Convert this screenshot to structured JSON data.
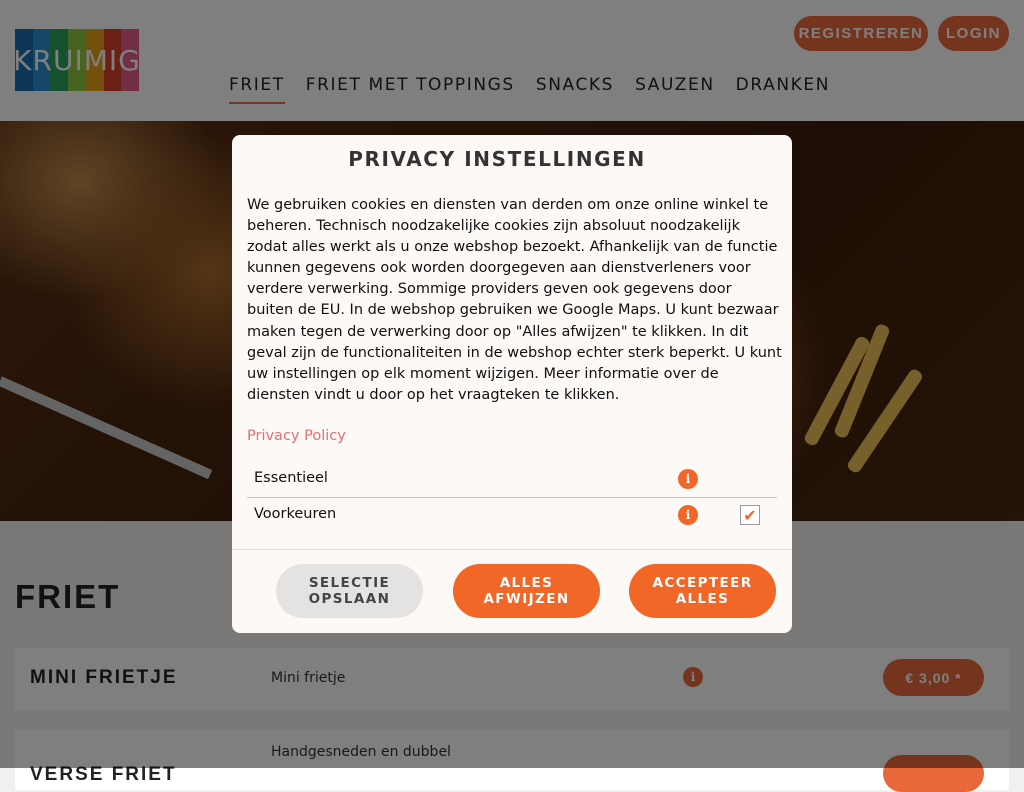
{
  "header": {
    "logo_text": "KRUIMIG",
    "logo_colors": [
      "#1a6fae",
      "#2a8fd0",
      "#2ca25f",
      "#8cc63f",
      "#e8a317",
      "#d9412b",
      "#e45c8a"
    ],
    "buttons": {
      "register": "REGISTREREN",
      "login": "LOGIN"
    },
    "nav": [
      {
        "label": "FRIET",
        "active": true
      },
      {
        "label": "FRIET MET TOPPINGS",
        "active": false
      },
      {
        "label": "SNACKS",
        "active": false
      },
      {
        "label": "SAUZEN",
        "active": false
      },
      {
        "label": "DRANKEN",
        "active": false
      }
    ]
  },
  "main": {
    "section_title": "FRIET",
    "products": [
      {
        "name": "MINI FRIETJE",
        "description": "Mini frietje",
        "price": "€ 3,00 *"
      },
      {
        "name": "VERSE FRIET",
        "description": "Handgesneden en dubbel",
        "price": ""
      }
    ]
  },
  "modal": {
    "title": "PRIVACY INSTELLINGEN",
    "body": "We gebruiken cookies en diensten van derden om onze online winkel te beheren. Technisch noodzakelijke cookies zijn absoluut noodzakelijk zodat alles werkt als u onze webshop bezoekt. Afhankelijk van de functie kunnen gegevens ook worden doorgegeven aan dienstverleners voor verdere verwerking. Sommige providers geven ook gegevens door buiten de EU. In de webshop gebruiken we Google Maps. U kunt bezwaar maken tegen de verwerking door op \"Alles afwijzen\" te klikken. In dit geval zijn de functionaliteiten in de webshop echter sterk beperkt. U kunt uw instellingen op elk moment wijzigen. Meer informatie over de diensten vindt u door op het vraagteken te klikken.",
    "privacy_link": "Privacy Policy",
    "settings": [
      {
        "label": "Essentieel",
        "checked": false
      },
      {
        "label": "Voorkeuren",
        "checked": true
      }
    ],
    "buttons": {
      "save": "SELECTIE\nOPSLAAN",
      "reject": "ALLES\nAFWIJZEN",
      "accept": "ACCEPTEER\nALLES"
    }
  },
  "colors": {
    "accent": "#f26628",
    "link": "#e46f73"
  },
  "icons": {
    "info": "info-icon",
    "check": "checkmark-icon"
  }
}
